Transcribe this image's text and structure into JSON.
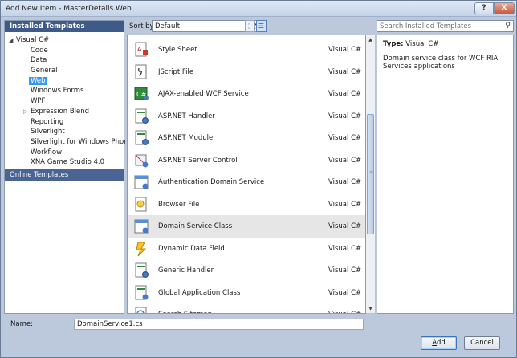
{
  "window": {
    "title": "Add New Item - MasterDetails.Web",
    "help_glyph": "?",
    "close_glyph": "X"
  },
  "left": {
    "header": "Installed Templates",
    "root": "Visual C#",
    "items": [
      "Code",
      "Data",
      "General",
      "Web",
      "Windows Forms",
      "WPF",
      "Expression Blend",
      "Reporting",
      "Silverlight",
      "Silverlight for Windows Phone",
      "Workflow",
      "XNA Game Studio 4.0"
    ],
    "selected": "Web",
    "online": "Online Templates"
  },
  "toolbar": {
    "sort_label": "Sort by:",
    "sort_value": "Default"
  },
  "search": {
    "placeholder": "Search Installed Templates"
  },
  "templates": [
    {
      "name": "Style Sheet",
      "lang": "Visual C#",
      "icon": "css-icon"
    },
    {
      "name": "JScript File",
      "lang": "Visual C#",
      "icon": "js-icon"
    },
    {
      "name": "AJAX-enabled WCF Service",
      "lang": "Visual C#",
      "icon": "wcf-icon"
    },
    {
      "name": "ASP.NET Handler",
      "lang": "Visual C#",
      "icon": "handler-icon"
    },
    {
      "name": "ASP.NET Module",
      "lang": "Visual C#",
      "icon": "module-icon"
    },
    {
      "name": "ASP.NET Server Control",
      "lang": "Visual C#",
      "icon": "server-control-icon"
    },
    {
      "name": "Authentication Domain Service",
      "lang": "Visual C#",
      "icon": "auth-service-icon"
    },
    {
      "name": "Browser File",
      "lang": "Visual C#",
      "icon": "browser-file-icon"
    },
    {
      "name": "Domain Service Class",
      "lang": "Visual C#",
      "icon": "domain-service-icon"
    },
    {
      "name": "Dynamic Data Field",
      "lang": "Visual C#",
      "icon": "dynamic-data-icon"
    },
    {
      "name": "Generic Handler",
      "lang": "Visual C#",
      "icon": "generic-handler-icon"
    },
    {
      "name": "Global Application Class",
      "lang": "Visual C#",
      "icon": "global-app-icon"
    },
    {
      "name": "Search Sitemap",
      "lang": "Visual C#",
      "icon": "search-sitemap-icon"
    }
  ],
  "selected_template": "Domain Service Class",
  "details": {
    "type_label": "Type:",
    "type_value": "Visual C#",
    "description": "Domain service class for WCF RIA Services applications"
  },
  "name_field": {
    "label_prefix": "N",
    "label_rest": "ame:",
    "value": "DomainService1.cs"
  },
  "buttons": {
    "add_prefix": "A",
    "add_rest": "dd",
    "cancel": "Cancel"
  }
}
